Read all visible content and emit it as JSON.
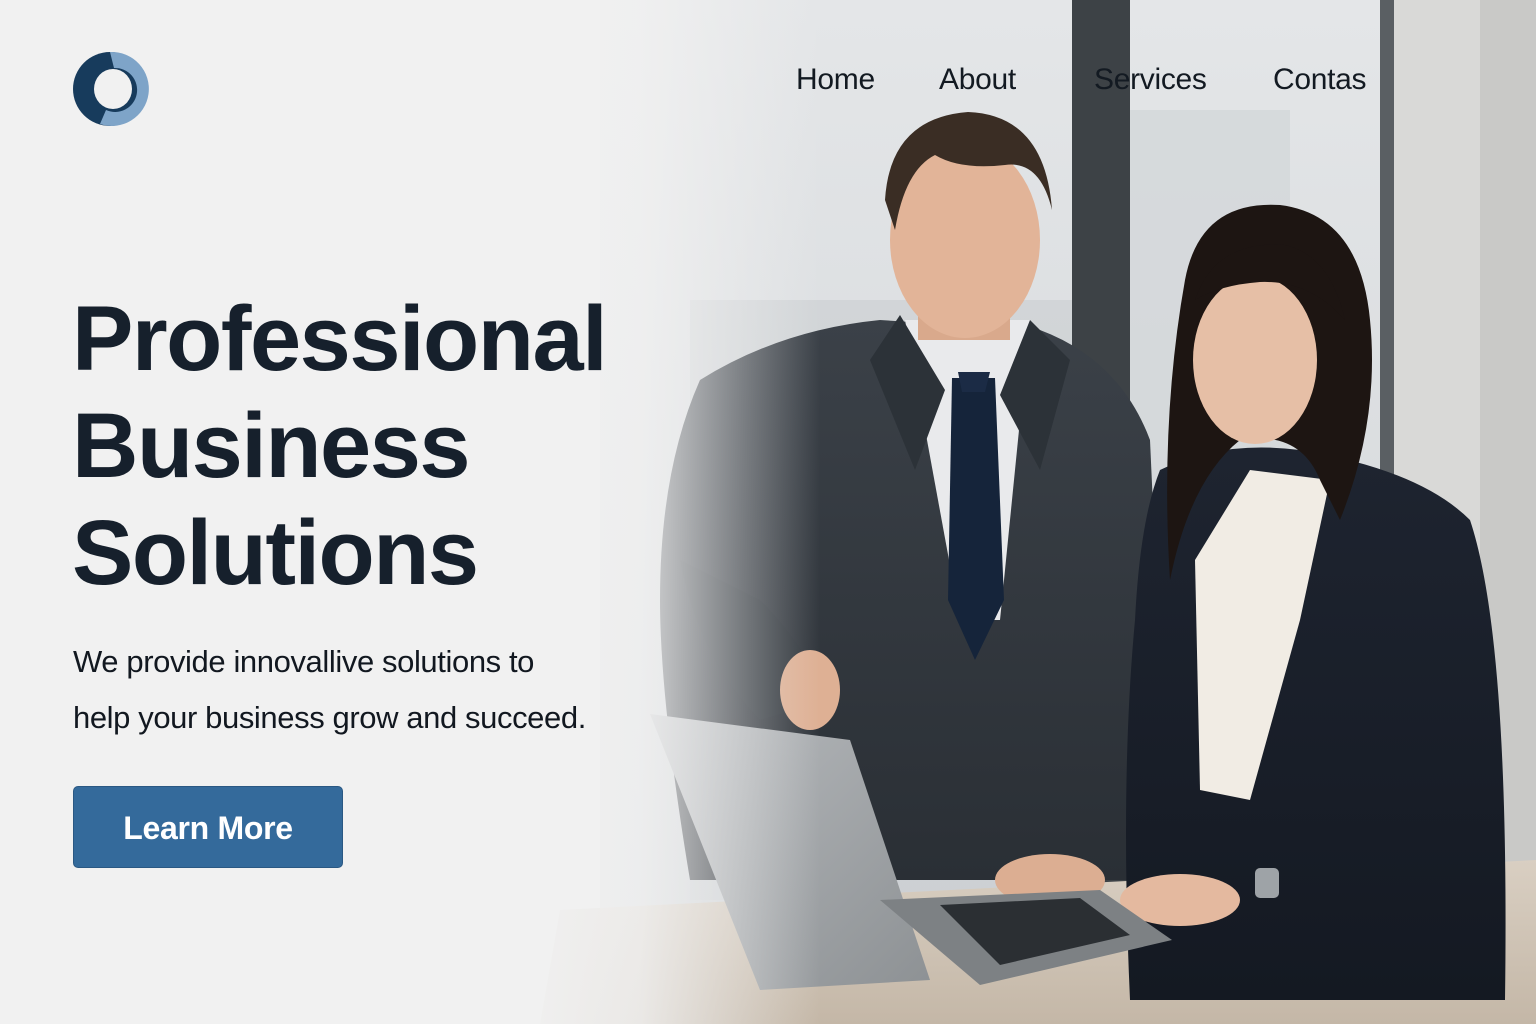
{
  "brand": {
    "logo_icon": "ring-logo-icon",
    "colors": {
      "logo_dark": "#173b5c",
      "logo_light": "#7ea4c8",
      "primary": "#346a9b",
      "text": "#16202c",
      "background": "#f1f1f1"
    }
  },
  "nav": {
    "items": [
      {
        "label": "Home"
      },
      {
        "label": "About"
      },
      {
        "label": "Services"
      },
      {
        "label": "Contas"
      }
    ]
  },
  "hero": {
    "title_lines": [
      "Professional",
      "Business",
      "Solutions"
    ],
    "subtitle_lines": [
      "We provide innovallive solutions to",
      "help your business grow and succeed."
    ],
    "cta_label": "Learn More",
    "image_subject": "two business professionals at a laptop in an office"
  }
}
